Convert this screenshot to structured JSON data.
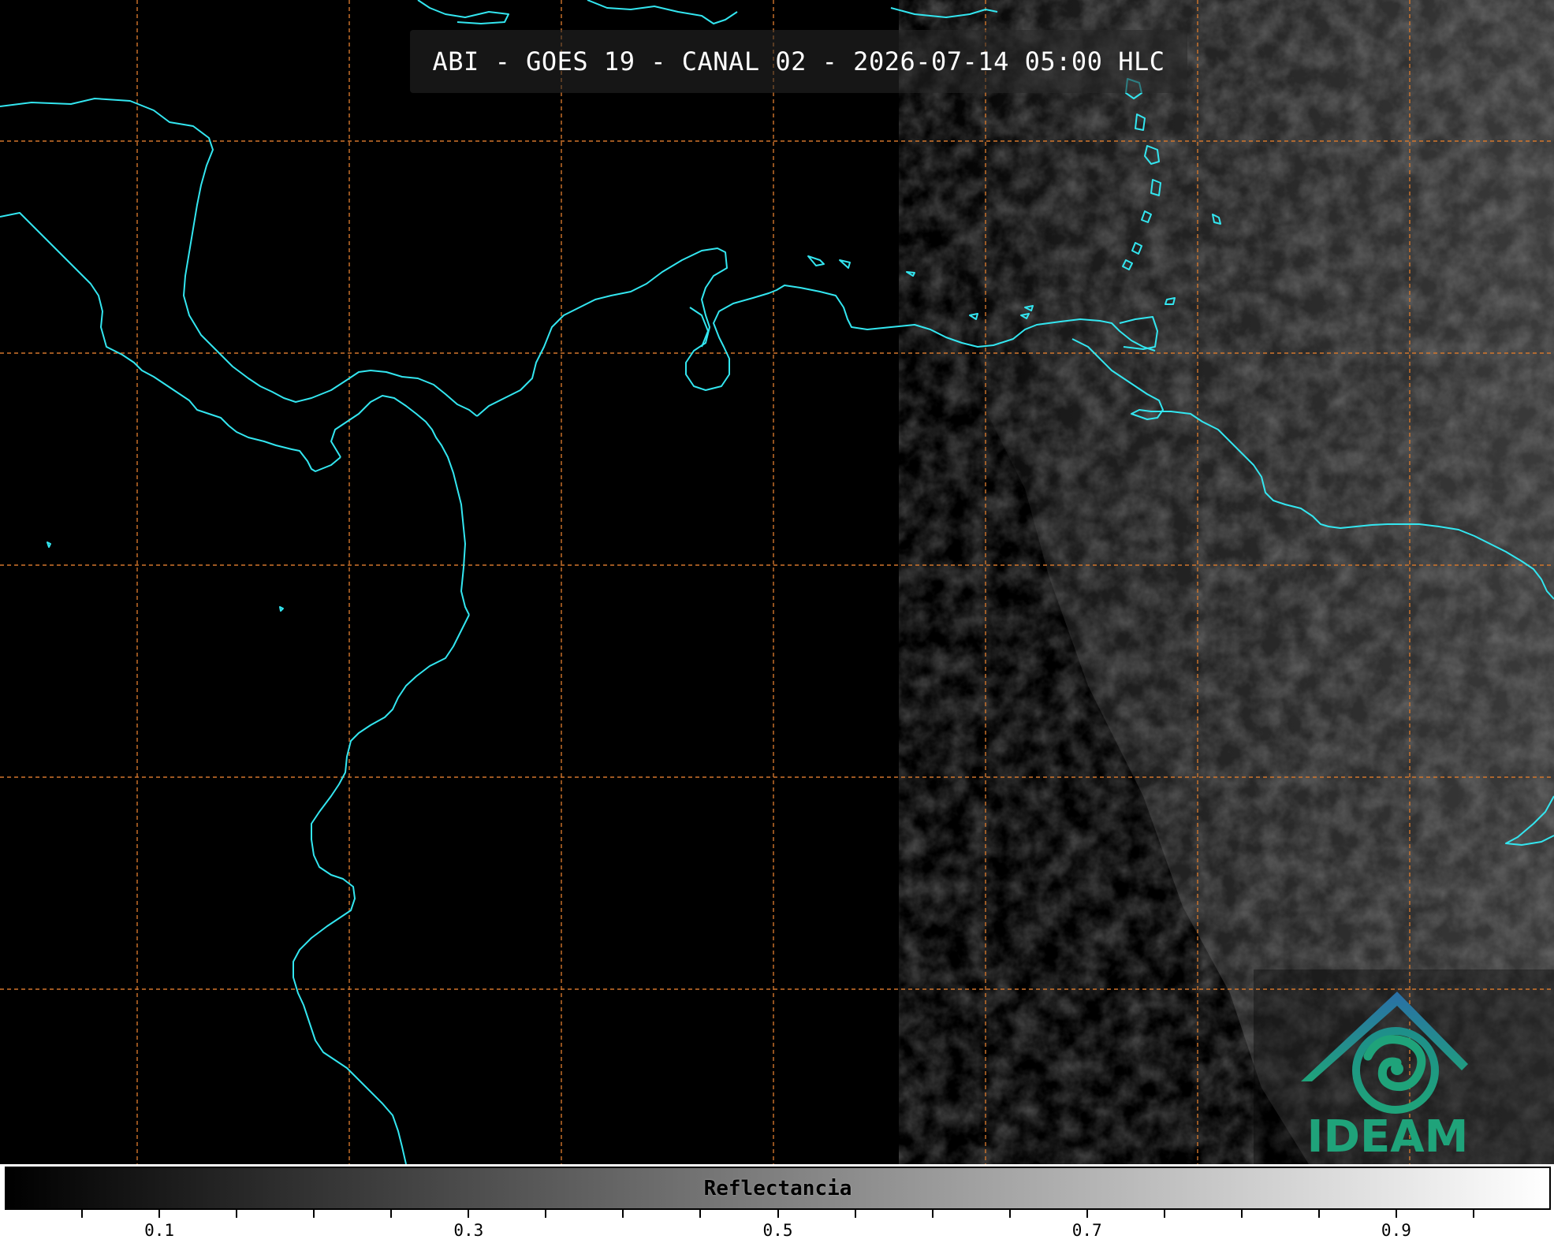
{
  "title": "ABI - GOES 19 - CANAL 02 - 2026-07-14 05:00 HLC",
  "logo": {
    "text": "IDEAM",
    "colors": {
      "roof": "#2a6fa8",
      "swirl": "#1fa37a"
    }
  },
  "colorbar": {
    "label": "Reflectancia",
    "range": [
      0.0,
      1.0
    ],
    "major_ticks": [
      0.1,
      0.3,
      0.5,
      0.7,
      0.9
    ],
    "major_tick_labels": [
      "0.1",
      "0.3",
      "0.5",
      "0.7",
      "0.9"
    ],
    "minor_step": 0.05,
    "colormap": "grayscale black-to-white"
  },
  "map": {
    "coastline_color": "#33e6f0",
    "gridline_color": "#d2762c",
    "gridline_style": "dashed",
    "background_color": "#000000"
  }
}
